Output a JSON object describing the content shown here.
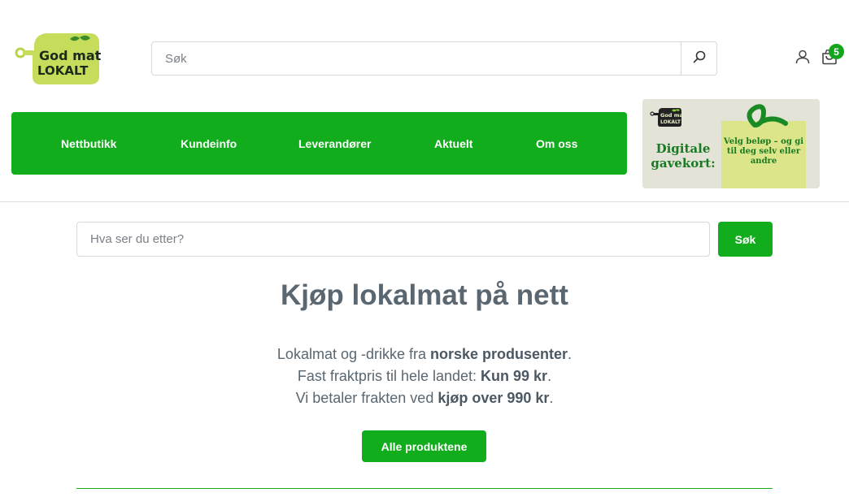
{
  "header": {
    "logo_text": [
      "God mat",
      "LOKALT"
    ],
    "search": {
      "placeholder": "Søk"
    },
    "cart_count": "5"
  },
  "nav": {
    "items": [
      {
        "label": "Nettbutikk"
      },
      {
        "label": "Kundeinfo"
      },
      {
        "label": "Leverandører"
      },
      {
        "label": "Aktuelt"
      },
      {
        "label": "Om oss"
      }
    ]
  },
  "giftcard": {
    "title": "Digitale gavekort:",
    "tagline": "Velg beløp – og gi til deg selv eller andre"
  },
  "content": {
    "search": {
      "placeholder": "Hva ser du etter?",
      "button_label": "Søk"
    },
    "title": "Kjøp lokalmat på nett",
    "lines": [
      {
        "pre": "Lokalmat og -drikke fra ",
        "bold": "norske produsenter",
        "post": "."
      },
      {
        "pre": "Fast fraktpris til hele landet: ",
        "bold": "Kun 99 kr",
        "post": "."
      },
      {
        "pre": "Vi betaler frakten ved ",
        "bold": "kjøp over 990 kr",
        "post": "."
      }
    ],
    "cta_label": "Alle produktene"
  },
  "colors": {
    "brand_green": "#12ad1c",
    "text": "#5a6670",
    "giftcard_bg": "#e3e4d7",
    "tag_bg": "#dde58a"
  },
  "icons": {
    "search": "search-icon",
    "user": "user-icon",
    "cart": "cart-icon"
  }
}
